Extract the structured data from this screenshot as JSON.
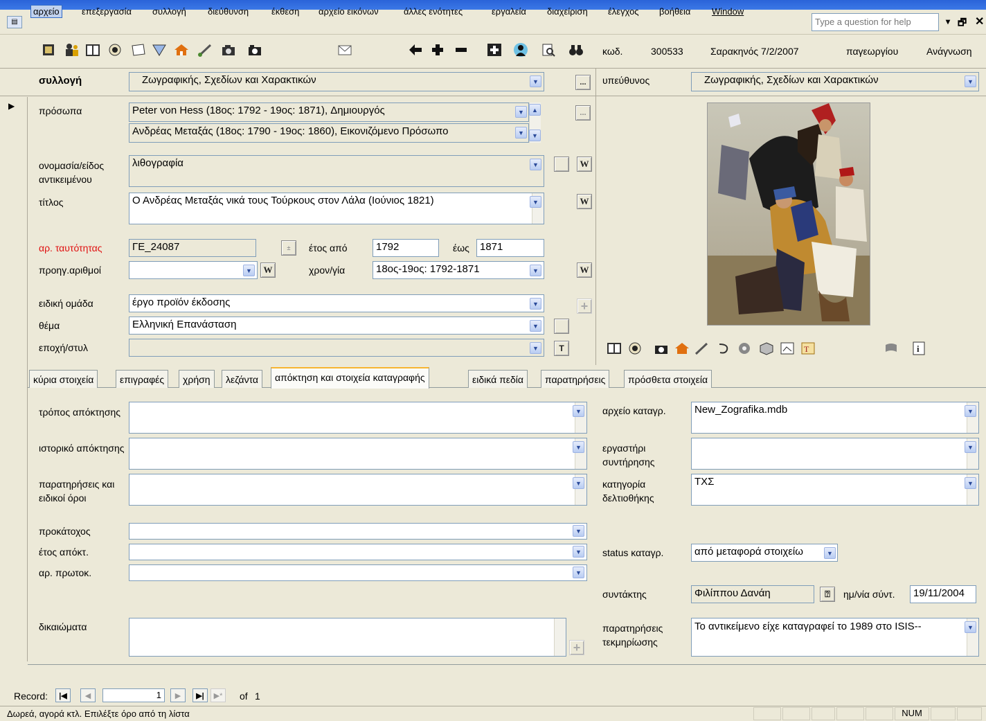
{
  "menu": {
    "items": [
      "αρχείο",
      "επεξεργασία",
      "συλλογή",
      "διεύθυνση",
      "έκθεση",
      "αρχείο εικόνων",
      "άλλες ενότητες",
      "εργαλεία",
      "διαχείριση",
      "έλεγχος",
      "βοήθεια",
      "Window"
    ],
    "help_placeholder": "Type a question for help"
  },
  "toolbar_icons": [
    "card-icon",
    "users-icon",
    "book-icon",
    "eye-icon",
    "page-icon",
    "shape-icon",
    "home-icon",
    "brush-icon",
    "camera-icon",
    "mail-icon",
    "arrow-left-icon",
    "plus-icon",
    "minus-icon",
    "add-record-icon",
    "figure-icon",
    "print-preview-icon",
    "binoculars-icon"
  ],
  "header": {
    "code_label": "κωδ.",
    "code_value": "300533",
    "author_date": "Σαρακηνός 7/2/2007",
    "location": "παγεωργίου",
    "mode": "Ανάγνωση"
  },
  "collection": {
    "label": "συλλογή",
    "value": "Ζωγραφικής, Σχεδίων και Χαρακτικών",
    "btn": "...",
    "responsible_label": "υπεύθυνος",
    "responsible_value": "Ζωγραφικής, Σχεδίων και Χαρακτικών"
  },
  "persons": {
    "label": "πρόσωπα",
    "rows": [
      "Peter von Hess (18ος: 1792 - 19ος: 1871), Δημιουργός",
      "Ανδρέας Μεταξάς (18ος: 1790 - 19ος: 1860), Εικονιζόμενο Πρόσωπο"
    ],
    "btn": "..."
  },
  "object": {
    "name_label": "ονομασία/είδος αντικειμένου",
    "name_value": "λιθογραφία",
    "title_label": "τίτλος",
    "title_value": "Ο Ανδρέας  Μεταξάς νικά τους Τούρκους στον Λάλα (Ιούνιος 1821)",
    "id_label": "αρ. ταυτότητας",
    "id_value": "ΓΕ_24087",
    "year_from_label": "έτος από",
    "year_from": "1792",
    "year_to_label": "έως",
    "year_to": "1871",
    "prev_label": "προηγ.αριθμοί",
    "prev_value": "",
    "chrono_label": "χρον/γία",
    "chrono_value": "18ος-19ος: 1792-1871",
    "group_label": "ειδική ομάδα",
    "group_value": "έργο προϊόν έκδοσης",
    "theme_label": "θέμα",
    "theme_value": "Ελληνική Επανάσταση",
    "era_label": "εποχή/στυλ",
    "era_value": "",
    "w_label": "W",
    "t_label": "T",
    "plus_label": "+"
  },
  "tabs": [
    "κύρια στοιχεία",
    "επιγραφές",
    "χρήση",
    "λεζάντα",
    "απόκτηση και στοιχεία καταγραφής",
    "ειδικά πεδία",
    "παρατηρήσεις",
    "πρόσθετα στοιχεία"
  ],
  "active_tab": 4,
  "acquisition": {
    "method_label": "τρόπος απόκτησης",
    "method_value": "",
    "history_label": "ιστορικό απόκτησης",
    "history_value": "",
    "notes_label": "παρατηρήσεις και ειδικοί όροι",
    "notes_value": "",
    "prev_owner_label": "προκάτοχος",
    "prev_owner_value": "",
    "year_label": "έτος απόκτ.",
    "year_value": "",
    "protocol_label": "αρ. πρωτοκ.",
    "protocol_value": "",
    "rights_label": "δικαιώματα",
    "rights_value": ""
  },
  "record_info": {
    "file_label": "αρχείο καταγρ.",
    "file_value": "New_Zografika.mdb",
    "lab_label": "εργαστήρι συντήρησης",
    "lab_value": "",
    "category_label": "κατηγορία δελτιοθήκης",
    "category_value": "ΤΧΣ",
    "status_label": "status καταγρ.",
    "status_value": "από μεταφορά στοιχείω",
    "author_label": "συντάκτης",
    "author_value": "Φιλίππου Δανάη",
    "date_label": "ημ/νία σύντ.",
    "date_value": "19/11/2004",
    "doc_notes_label": "παρατηρήσεις τεκμηρίωσης",
    "doc_notes_value": "Το αντικείμενο είχε καταγραφεί το 1989 στο ISIS--"
  },
  "navigator": {
    "record_label": "Record:",
    "current": "1",
    "of_label": "of",
    "total": "1"
  },
  "status": {
    "message": "Δωρεά, αγορά κτλ. Επιλέξτε όρο από τη λίστα",
    "num": "NUM"
  }
}
